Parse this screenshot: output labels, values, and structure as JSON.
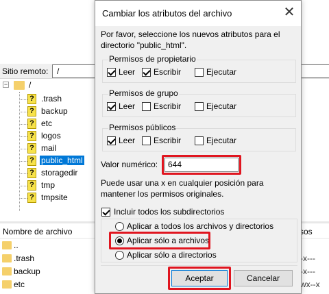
{
  "background": {
    "remote_label": "Sitio remoto:",
    "remote_path": "/",
    "tree": {
      "toggle": "−",
      "root": "/",
      "items": [
        ".trash",
        "backup",
        "etc",
        "logos",
        "mail",
        "public_html",
        "storagedir",
        "tmp",
        "tmpsite"
      ],
      "selected": "public_html"
    },
    "filelist": {
      "header_name": "Nombre de archivo",
      "header_right": "sos",
      "rows": [
        {
          "name": "..",
          "perm": ""
        },
        {
          "name": ".trash",
          "perm": "-x---"
        },
        {
          "name": "backup",
          "perm": "-x---"
        },
        {
          "name": "etc",
          "perm": "wx--x"
        }
      ]
    }
  },
  "dialog": {
    "title": "Cambiar los atributos del archivo",
    "close_glyph": "✕",
    "description": "Por favor, seleccione los nuevos atributos para el directorio \"public_html\".",
    "groups": [
      {
        "title": "Permisos de propietario",
        "read": {
          "label": "Leer",
          "checked": true
        },
        "write": {
          "label": "Escribir",
          "checked": true
        },
        "exec": {
          "label": "Ejecutar",
          "checked": false
        }
      },
      {
        "title": "Permisos de grupo",
        "read": {
          "label": "Leer",
          "checked": true
        },
        "write": {
          "label": "Escribir",
          "checked": false
        },
        "exec": {
          "label": "Ejecutar",
          "checked": false
        }
      },
      {
        "title": "Permisos públicos",
        "read": {
          "label": "Leer",
          "checked": true
        },
        "write": {
          "label": "Escribir",
          "checked": false
        },
        "exec": {
          "label": "Ejecutar",
          "checked": false
        }
      }
    ],
    "numeric_label": "Valor numérico:",
    "numeric_value": "644",
    "hint": "Puede usar una x en cualquier posición para mantener los permisos originales.",
    "recurse": {
      "label": "Incluir todos los subdirectorios",
      "checked": true
    },
    "radios": [
      {
        "label": "Aplicar a todos los archivos y directorios",
        "selected": false
      },
      {
        "label": "Aplicar sólo a archivos",
        "selected": true
      },
      {
        "label": "Aplicar sólo a directorios",
        "selected": false
      }
    ],
    "ok_label": "Aceptar",
    "cancel_label": "Cancelar"
  },
  "colors": {
    "highlight": "#e0151f",
    "selection": "#0078d7",
    "folder": "#f5d06b"
  }
}
